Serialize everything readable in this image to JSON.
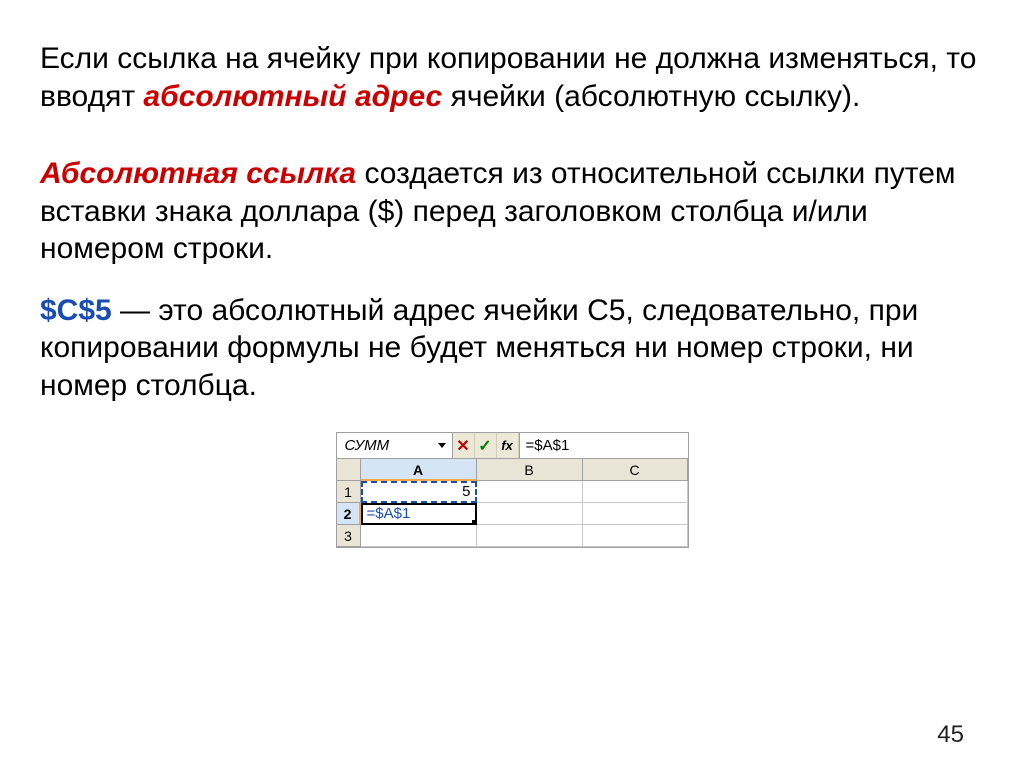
{
  "para1": {
    "t1": "Если ссылка на ячейку при копировании не должна изменяться, то вводят ",
    "em": "абсолютный адрес",
    "t2": " ячейки (абсолютную ссылку)."
  },
  "para2": {
    "em": "Абсолютная ссылка",
    "t1": " создается из относительной ссылки путем вставки знака доллара ($) перед заголовком столбца и/или номером строки."
  },
  "para3": {
    "bold": "$C$5",
    "t1": " — это абсолютный адрес ячейки С5, следовательно, при копировании формулы не будет меняться ни номер строки, ни номер столбца."
  },
  "excel": {
    "namebox": "СУММ",
    "cancel": "✕",
    "enter": "✓",
    "fx": "fx",
    "formula": "=$A$1",
    "cols": {
      "a": "A",
      "b": "B",
      "c": "C"
    },
    "rows": {
      "r1": "1",
      "r2": "2",
      "r3": "3"
    },
    "a1": "5",
    "a2": "=$A$1"
  },
  "page": "45"
}
